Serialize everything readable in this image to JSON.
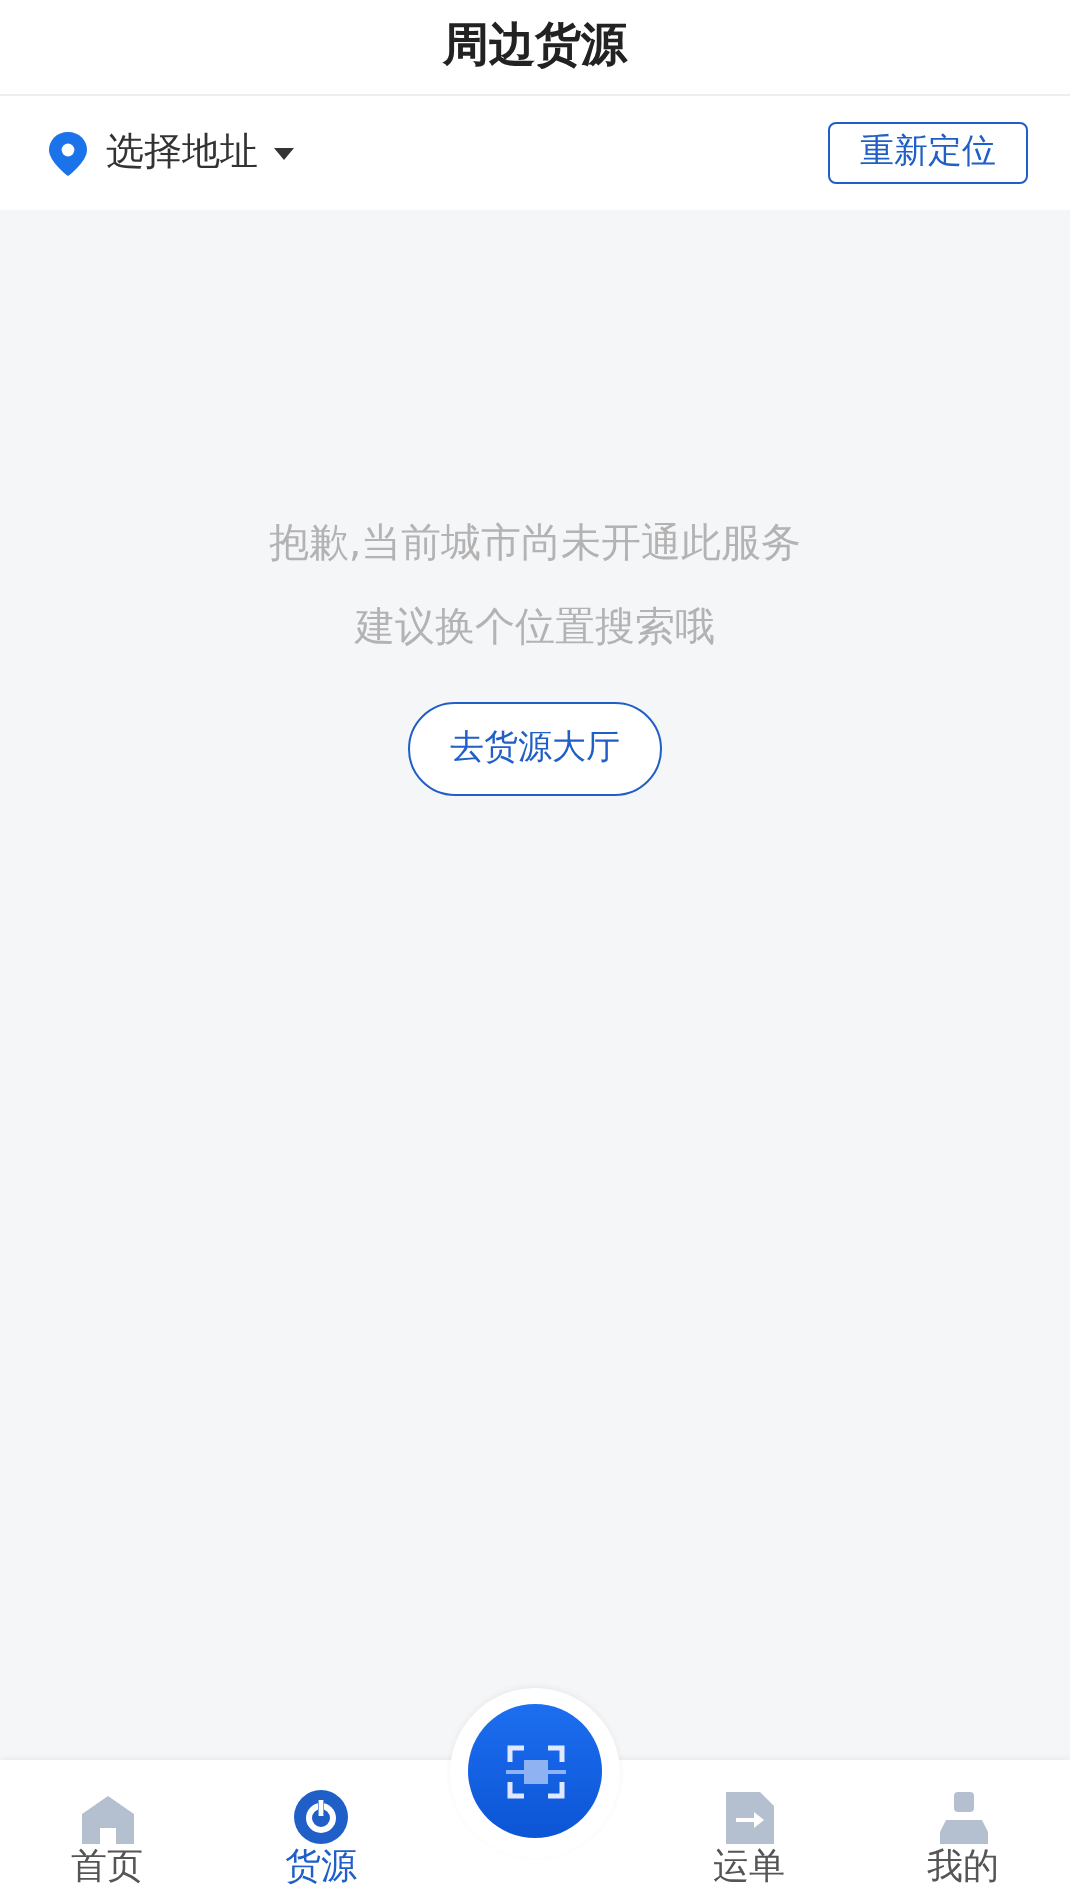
{
  "header": {
    "title": "周边货源"
  },
  "location_bar": {
    "address": "选择地址",
    "relocate_button": "重新定位"
  },
  "empty_state": {
    "lines": [
      "抱歉,当前城市尚未开通此服务",
      "建议换个位置搜索哦"
    ],
    "button": "去货源大厅"
  },
  "tab_bar": {
    "items": [
      {
        "kind": "home",
        "label": "首页",
        "selected": false
      },
      {
        "kind": "cargo",
        "label": "货源",
        "selected": true
      },
      {
        "kind": "scan"
      },
      {
        "kind": "waybill",
        "label": "运单",
        "selected": false
      },
      {
        "kind": "mine",
        "label": "我的",
        "selected": false
      }
    ]
  }
}
